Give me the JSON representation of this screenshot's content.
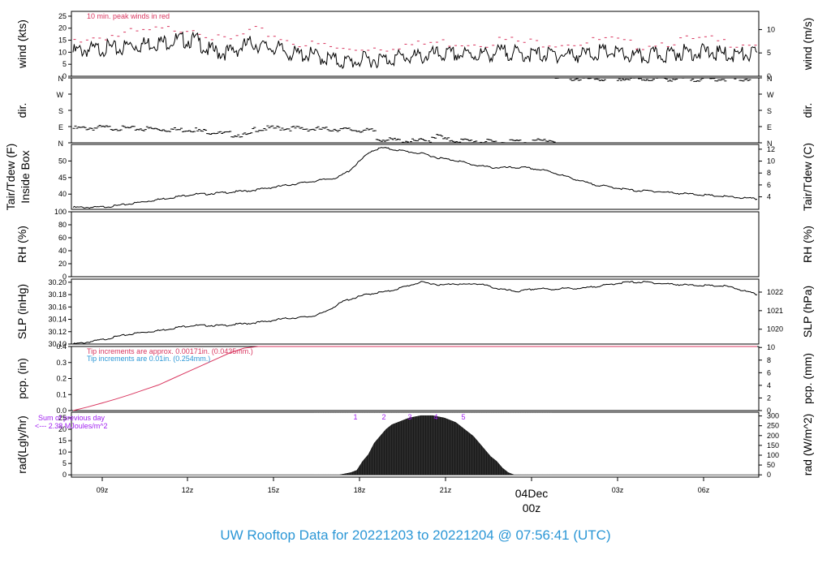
{
  "title": "UW Rooftop Data for 20221203  to  20221204 @ 07:56:41  (UTC)",
  "colors": {
    "red": "#d9365f",
    "blue": "#2c97d6",
    "purple": "#a020f0",
    "line": "#000000"
  },
  "chart_data": [
    {
      "id": "wind",
      "type": "line",
      "ylabel": "wind (kts)",
      "ylabel_right": "wind (m/s)",
      "ylim": [
        0,
        27
      ],
      "yticks": [
        0,
        5,
        10,
        15,
        20,
        25
      ],
      "ylim_right": [
        0,
        13.9
      ],
      "yticks_right": [
        0,
        5,
        10
      ],
      "annotation": "10 min. peak winds in red",
      "series": [
        {
          "values": [
            10,
            11,
            11,
            12,
            11,
            13,
            13,
            14,
            14,
            15,
            15,
            15,
            11,
            10,
            10,
            12,
            14,
            12,
            12,
            10,
            9,
            9,
            8,
            7,
            6,
            6,
            7,
            7,
            7,
            8,
            8,
            8,
            9,
            9,
            9,
            9,
            9,
            9,
            10,
            10,
            9,
            9,
            9,
            9,
            9,
            9,
            9,
            10,
            10,
            9,
            8,
            8,
            9,
            9,
            10,
            10,
            10,
            10,
            9,
            9,
            9,
            9
          ]
        },
        {
          "values": [
            15,
            16,
            16,
            17,
            17,
            18,
            18,
            19,
            19,
            20,
            20,
            20,
            17,
            15,
            15,
            17,
            19,
            18,
            17,
            15,
            14,
            13,
            13,
            12,
            11,
            11,
            12,
            12,
            12,
            13,
            13,
            13,
            14,
            14,
            14,
            14,
            14,
            14,
            15,
            15,
            14,
            14,
            14,
            14,
            14,
            14,
            14,
            15,
            15,
            14,
            13,
            13,
            14,
            14,
            15,
            15,
            15,
            15,
            14,
            14,
            14,
            14
          ]
        }
      ]
    },
    {
      "id": "dir",
      "type": "scatter",
      "ylabel": "dir.",
      "ylabel_right": "dir.",
      "ycategories": [
        "N",
        "E",
        "S",
        "W",
        "N"
      ],
      "ylim": [
        0,
        360
      ],
      "series": [
        {
          "values": [
            80,
            82,
            84,
            82,
            80,
            78,
            78,
            76,
            74,
            72,
            74,
            64,
            60,
            50,
            45,
            42,
            76,
            80,
            82,
            80,
            78,
            76,
            74,
            76,
            72,
            70,
            66,
            20,
            14,
            10,
            8,
            12,
            36,
            16,
            12,
            10,
            6,
            4,
            2,
            8,
            4,
            10,
            14,
            358,
            356,
            354,
            355,
            354,
            355,
            354,
            353,
            354,
            356,
            354,
            355,
            354,
            353,
            354,
            355,
            354,
            355,
            354
          ]
        }
      ]
    },
    {
      "id": "temp",
      "type": "line",
      "ylabel": "Tair/Tdew (F)",
      "ylabel2": "Inside Box",
      "ylabel_right": "Tair/Tdew (C)",
      "ylim": [
        35.4,
        55
      ],
      "yticks": [
        40,
        45,
        50
      ],
      "ylim_right": [
        1.9,
        12.8
      ],
      "yticks_right": [
        4,
        6,
        8,
        10,
        12
      ],
      "series": [
        {
          "values": [
            36,
            36,
            36,
            36.2,
            36.5,
            37,
            37.5,
            38,
            38.5,
            39,
            39.5,
            40,
            40,
            40.3,
            40.5,
            40.8,
            41,
            41.5,
            42,
            42.5,
            43,
            43.5,
            44,
            44.5,
            45,
            47,
            50,
            53,
            54,
            53.5,
            53,
            52.5,
            52,
            51,
            50.5,
            50,
            49,
            48.5,
            48,
            48,
            48,
            48,
            47.5,
            47,
            46,
            45,
            44,
            43,
            42.5,
            42,
            41.5,
            41,
            41,
            40.8,
            40.5,
            40.2,
            40,
            39.8,
            39.5,
            39.3,
            39,
            38.8,
            38.5
          ]
        }
      ]
    },
    {
      "id": "rh",
      "type": "line",
      "ylabel": "RH (%)",
      "ylabel_right": "RH (%)",
      "ylim": [
        0,
        100
      ],
      "yticks": [
        0,
        20,
        40,
        60,
        80,
        100
      ],
      "series": []
    },
    {
      "id": "slp",
      "type": "line",
      "ylabel": "SLP (inHg)",
      "ylabel_right": "SLP (hPa)",
      "ylim": [
        30.1,
        30.205
      ],
      "yticks": [
        30.1,
        30.12,
        30.14,
        30.16,
        30.18,
        30.2
      ],
      "yticklabels": [
        "30.10",
        "30.12",
        "30.14",
        "30.16",
        "30.18",
        "30.20"
      ],
      "ylim_right": [
        1019.2,
        1022.7
      ],
      "yticks_right": [
        1020,
        1021,
        1022
      ],
      "series": [
        {
          "values": [
            30.1,
            30.102,
            30.105,
            30.108,
            30.112,
            30.115,
            30.118,
            30.12,
            30.122,
            30.125,
            30.128,
            30.13,
            30.13,
            30.13,
            30.13,
            30.132,
            30.133,
            30.135,
            30.137,
            30.14,
            30.142,
            30.143,
            30.145,
            30.15,
            30.16,
            30.17,
            30.175,
            30.18,
            30.183,
            30.185,
            30.19,
            30.195,
            30.2,
            30.198,
            30.195,
            30.198,
            30.196,
            30.198,
            30.195,
            30.19,
            30.187,
            30.185,
            30.188,
            30.19,
            30.188,
            30.19,
            30.19,
            30.19,
            30.193,
            30.195,
            30.198,
            30.2,
            30.2,
            30.2,
            30.198,
            30.197,
            30.196,
            30.195,
            30.195,
            30.194,
            30.194,
            30.19,
            30.185,
            30.18
          ]
        }
      ]
    },
    {
      "id": "pcp",
      "type": "line",
      "ylabel": "pcp. (in)",
      "ylabel_right": "pcp. (mm)",
      "ylim": [
        0,
        0.4
      ],
      "yticks": [
        0,
        0.1,
        0.2,
        0.3,
        0.4
      ],
      "yticklabels": [
        "0.0",
        "0.1",
        "0.2",
        "0.3",
        "0.4"
      ],
      "ylim_right": [
        0,
        10.16
      ],
      "yticks_right": [
        0,
        2,
        4,
        6,
        8,
        10
      ],
      "annotations": [
        {
          "text": "Tip increments are approx. 0.00171in. (0.0435mm.)",
          "color": "red"
        },
        {
          "text": "Tip increments are 0.01in. (0.254mm.)",
          "color": "blue"
        }
      ],
      "series": [
        {
          "values": [
            0,
            0.022,
            0.046,
            0.072,
            0.1,
            0.13,
            0.16,
            0.2,
            0.24,
            0.28,
            0.32,
            0.36,
            0.39,
            0.4,
            0.4,
            0.4,
            0.4,
            0.4,
            0.4,
            0.4,
            0.4,
            0.4,
            0.4,
            0.4,
            0.4,
            0.4,
            0.4,
            0.4,
            0.4,
            0.4,
            0.4,
            0.4,
            0.4,
            0.4,
            0.4,
            0.4,
            0.4,
            0.4,
            0.4,
            0.4,
            0.4,
            0.4,
            0.4,
            0.4,
            0.4,
            0.4,
            0.4,
            0.4,
            0.4
          ]
        }
      ]
    },
    {
      "id": "rad",
      "type": "area",
      "ylabel": "rad(Lgly/hr)",
      "ylabel_right": "rad (W/m^2)",
      "ylim": [
        -1,
        27.5
      ],
      "yticks": [
        0,
        5,
        10,
        15,
        20,
        25
      ],
      "ylim_right": [
        -11.6,
        319
      ],
      "yticks_right": [
        0,
        50,
        100,
        150,
        200,
        250,
        300
      ],
      "annotations": [
        "Sum of previous day",
        "<--- 2.38 MJoules/m^2"
      ],
      "hour_markers": [
        "1",
        "2",
        "3",
        "4",
        "5"
      ],
      "series": [
        {
          "values": [
            0,
            0,
            0,
            0,
            0,
            0,
            0,
            0,
            0,
            0,
            0,
            0,
            0,
            0,
            0,
            0,
            0,
            0,
            0,
            0,
            0,
            0,
            0,
            0,
            0,
            0,
            0,
            0,
            0,
            0,
            0,
            0,
            0,
            0,
            0,
            0,
            0,
            0,
            0,
            0,
            0,
            0,
            0,
            0,
            0,
            0,
            0,
            0.5,
            1,
            2,
            6,
            9,
            14,
            17,
            20,
            22,
            23,
            24,
            25,
            25.5,
            26,
            26,
            26,
            25.5,
            25,
            24,
            23,
            21,
            19,
            17,
            14,
            11,
            8,
            6,
            3,
            1,
            0,
            0,
            0,
            0,
            0,
            0,
            0,
            0,
            0,
            0,
            0,
            0,
            0,
            0,
            0,
            0,
            0,
            0,
            0,
            0,
            0,
            0,
            0,
            0,
            0,
            0,
            0,
            0,
            0,
            0,
            0,
            0,
            0,
            0,
            0,
            0,
            0,
            0,
            0,
            0,
            0,
            0,
            0
          ]
        }
      ]
    }
  ],
  "x_axis": {
    "ticks": [
      "09z",
      "12z",
      "15z",
      "18z",
      "21z",
      "00z",
      "03z",
      "06z"
    ],
    "day_label": "04Dec",
    "day_hour": "00z"
  }
}
